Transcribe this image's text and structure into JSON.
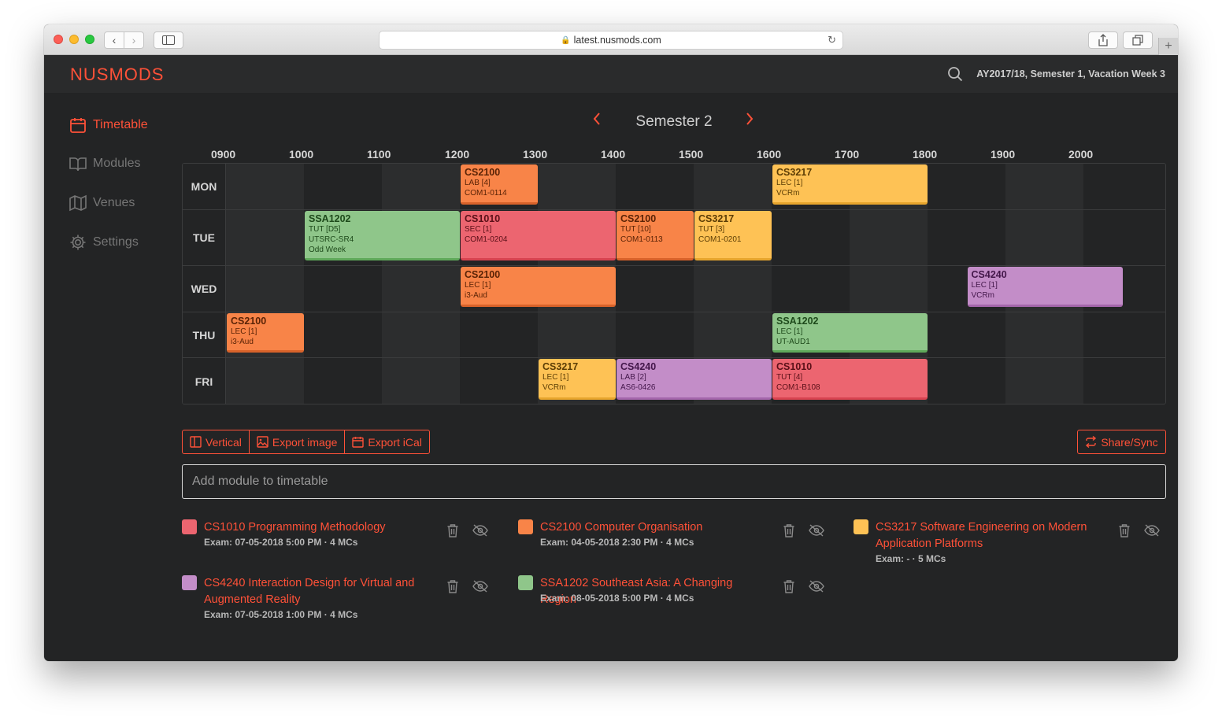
{
  "browser": {
    "url": "latest.nusmods.com"
  },
  "header": {
    "logo": "NUSMODS",
    "semester_info": "AY2017/18, Semester 1, Vacation Week 3"
  },
  "sidebar": {
    "items": [
      {
        "label": "Timetable"
      },
      {
        "label": "Modules"
      },
      {
        "label": "Venues"
      },
      {
        "label": "Settings"
      }
    ]
  },
  "semester_nav": {
    "title": "Semester 2",
    "prev": "‹",
    "next": "›"
  },
  "timetable": {
    "hours": [
      "0900",
      "1000",
      "1100",
      "1200",
      "1300",
      "1400",
      "1500",
      "1600",
      "1700",
      "1800",
      "1900",
      "2000"
    ],
    "days": [
      {
        "label": "MON",
        "lessons": [
          {
            "code": "CS2100",
            "type": "LAB [4]",
            "venue": "COM1-0114",
            "start": 12,
            "end": 13,
            "color": "orange"
          },
          {
            "code": "CS3217",
            "type": "LEC [1]",
            "venue": "VCRm",
            "start": 16,
            "end": 18,
            "color": "yellow"
          }
        ]
      },
      {
        "label": "TUE",
        "lessons": [
          {
            "code": "SSA1202",
            "type": "TUT [D5]",
            "venue": "UTSRC-SR4",
            "extra": "Odd Week",
            "start": 10,
            "end": 12,
            "color": "green"
          },
          {
            "code": "CS1010",
            "type": "SEC [1]",
            "venue": "COM1-0204",
            "start": 12,
            "end": 14,
            "color": "red"
          },
          {
            "code": "CS2100",
            "type": "TUT [10]",
            "venue": "COM1-0113",
            "start": 14,
            "end": 15,
            "color": "orange"
          },
          {
            "code": "CS3217",
            "type": "TUT [3]",
            "venue": "COM1-0201",
            "start": 15,
            "end": 16,
            "color": "yellow"
          }
        ]
      },
      {
        "label": "WED",
        "lessons": [
          {
            "code": "CS2100",
            "type": "LEC [1]",
            "venue": "i3-Aud",
            "start": 12,
            "end": 14,
            "color": "orange"
          },
          {
            "code": "CS4240",
            "type": "LEC [1]",
            "venue": "VCRm",
            "start": 18.5,
            "end": 20.5,
            "color": "purple"
          }
        ]
      },
      {
        "label": "THU",
        "lessons": [
          {
            "code": "CS2100",
            "type": "LEC [1]",
            "venue": "i3-Aud",
            "start": 9,
            "end": 10,
            "color": "orange"
          },
          {
            "code": "SSA1202",
            "type": "LEC [1]",
            "venue": "UT-AUD1",
            "start": 16,
            "end": 18,
            "color": "green"
          }
        ]
      },
      {
        "label": "FRI",
        "lessons": [
          {
            "code": "CS3217",
            "type": "LEC [1]",
            "venue": "VCRm",
            "start": 13,
            "end": 14,
            "color": "yellow"
          },
          {
            "code": "CS4240",
            "type": "LAB [2]",
            "venue": "AS6-0426",
            "start": 14,
            "end": 16,
            "color": "purple"
          },
          {
            "code": "CS1010",
            "type": "TUT [4]",
            "venue": "COM1-B108",
            "start": 16,
            "end": 18,
            "color": "red"
          }
        ]
      }
    ]
  },
  "toolbar": {
    "vertical_label": "Vertical",
    "export_image_label": "Export image",
    "export_ical_label": "Export iCal",
    "share_label": "Share/Sync"
  },
  "add_module": {
    "placeholder": "Add module to timetable"
  },
  "modules": [
    {
      "title": "CS1010 Programming Methodology",
      "exam": "Exam: 07-05-2018 5:00 PM · 4 MCs",
      "color": "#ec6570"
    },
    {
      "title": "CS2100 Computer Organisation",
      "exam": "Exam: 04-05-2018 2:30 PM · 4 MCs",
      "color": "#f88448"
    },
    {
      "title": "CS3217 Software Engineering on Modern Application Platforms",
      "exam": "Exam: - · 5 MCs",
      "color": "#fec255"
    },
    {
      "title": "CS4240 Interaction Design for Virtual and Augmented Reality",
      "exam": "Exam: 07-05-2018 1:00 PM · 4 MCs",
      "color": "#c38dc8"
    },
    {
      "title": "SSA1202 Southeast Asia: A Changing Region",
      "exam": "Exam: 08-05-2018 5:00 PM · 4 MCs",
      "color": "#8fc68a"
    }
  ],
  "colors": {
    "accent": "#ff5138",
    "background": "#232425"
  }
}
